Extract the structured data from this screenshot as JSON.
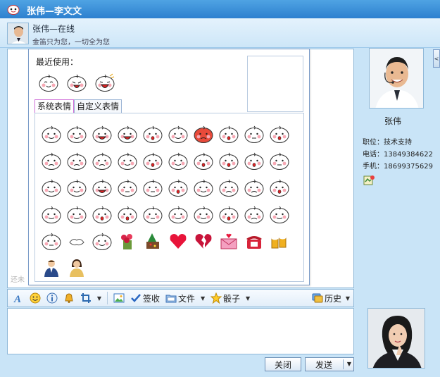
{
  "window": {
    "title": "张伟—李文文"
  },
  "header": {
    "name": "张伟—在线",
    "signature": "金笛只为您，一切全为您"
  },
  "chat": {
    "ghost_text": "还未"
  },
  "emoji_panel": {
    "recent_label": "最近使用：",
    "tabs": [
      "系统表情",
      "自定义表情"
    ],
    "active_tab": 0
  },
  "toolbar": {
    "sign_label": "签收",
    "file_label": "文件",
    "dice_label": "骰子",
    "history_label": "历史"
  },
  "buttons": {
    "close_label": "关闭",
    "send_label": "发送"
  },
  "contact": {
    "name": "张伟",
    "position": "职位：技术支持",
    "phone": "电话：13849384622",
    "mobile": "手机：18699375629"
  },
  "colors": {
    "titlebar": "#2d80cf",
    "window_bg": "#c9e4f7",
    "border": "#8fb8d8"
  }
}
